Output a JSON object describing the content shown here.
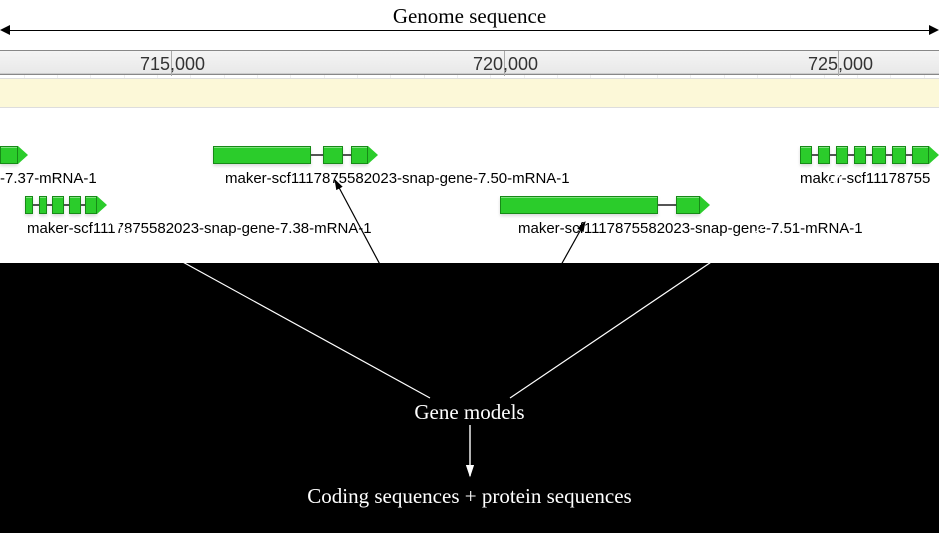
{
  "title_top": "Genome sequence",
  "ruler_ticks": [
    "715,000",
    "720,000",
    "725,000"
  ],
  "genes": {
    "g737_label": "-7.37-mRNA-1",
    "g750_label": "maker-scf1117875582023-snap-gene-7.50-mRNA-1",
    "g738_label": "maker-scf1117875582023-snap-gene-7.38-mRNA-1",
    "g751_label": "maker-scf1117875582023-snap-gene-7.51-mRNA-1",
    "gpartial_label": "maker-scf11178755"
  },
  "seq_label": "maker-scf11",
  "overlay": {
    "gene_models": "Gene models",
    "coding": "Coding sequences + protein sequences"
  }
}
